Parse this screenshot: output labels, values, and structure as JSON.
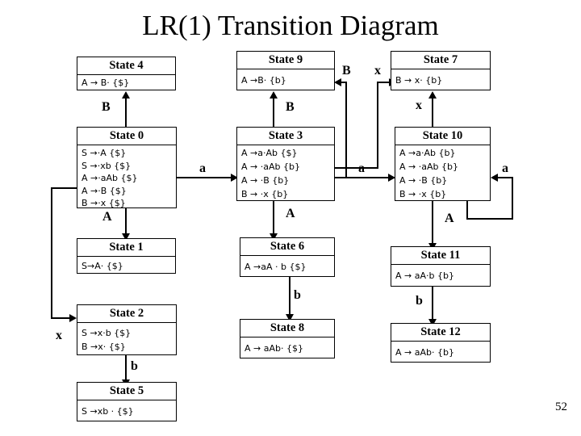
{
  "slide": {
    "title": "LR(1) Transition Diagram",
    "page_number": "52"
  },
  "states": {
    "s4": {
      "title": "State 4",
      "productions": [
        "A → B· {$}"
      ]
    },
    "s9": {
      "title": "State 9",
      "productions": [
        "A →B· {b}"
      ]
    },
    "s7": {
      "title": "State 7",
      "productions": [
        "B → x· {b}"
      ]
    },
    "s0": {
      "title": "State 0",
      "productions": [
        "S →·A {$}",
        "S →·xb {$}",
        "A →·aAb {$}",
        "A →·B {$}",
        "B →·x {$}"
      ]
    },
    "s3": {
      "title": "State 3",
      "productions": [
        "A →a·Ab {$}",
        "A → ·aAb {b}",
        "A → ·B {b}",
        "B → ·x {b}"
      ]
    },
    "s10": {
      "title": "State 10",
      "productions": [
        "A →a·Ab {b}",
        "A → ·aAb {b}",
        "A → ·B {b}",
        "B → ·x {b}"
      ]
    },
    "s1": {
      "title": "State 1",
      "productions": [
        "S→A· {$}"
      ]
    },
    "s6": {
      "title": "State 6",
      "productions": [
        "A →aA · b {$}"
      ]
    },
    "s11": {
      "title": "State 11",
      "productions": [
        "A → aA·b {b}"
      ]
    },
    "s2": {
      "title": "State 2",
      "productions": [
        "S →x·b {$}",
        "B →x· {$}"
      ]
    },
    "s8": {
      "title": "State 8",
      "productions": [
        "A → aAb· {$}"
      ]
    },
    "s12": {
      "title": "State 12",
      "productions": [
        "A → aAb· {b}"
      ]
    },
    "s5": {
      "title": "State 5",
      "productions": [
        "S →xb · {$}"
      ]
    }
  },
  "edges": {
    "s0_s4": "B",
    "s0_s1": "A",
    "s0_s2": "x",
    "s0_s3": "a",
    "s3_s9": "B",
    "s3_s7": "x",
    "s3_s6": "A",
    "s3_s10": "a",
    "s10_s7": "x",
    "s10_s10": "a",
    "s10_s11": "A",
    "s2_s5": "b",
    "s6_s8": "b",
    "s11_s12": "b"
  }
}
